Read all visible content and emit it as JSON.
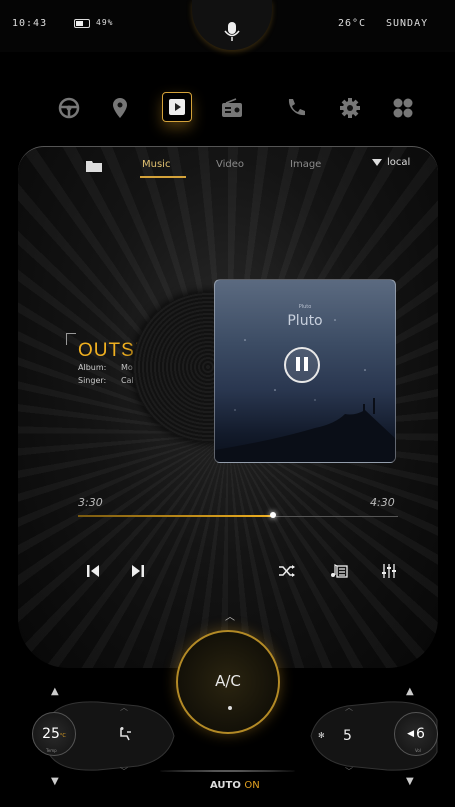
{
  "status": {
    "time": "10:43",
    "battery_pct": "49%",
    "battery_level": 0.49,
    "temperature": "26°C",
    "day": "SUNDAY"
  },
  "nav": {
    "items": [
      "steering-wheel",
      "location-pin",
      "media-play",
      "radio",
      "phone",
      "settings",
      "apps"
    ],
    "active": "media-play"
  },
  "media_tabs": {
    "music": "Music",
    "video": "Video",
    "image": "Image",
    "source": "local",
    "active": "Music"
  },
  "track": {
    "title": "OUTSIDE",
    "album_label": "Album:",
    "album": "Motion",
    "singer_label": "Singer:",
    "singer": "Calvin Harris",
    "card_caption_small": "Pluto",
    "card_caption": "Pluto"
  },
  "playback": {
    "elapsed": "3:30",
    "total": "4:30",
    "progress": 0.61
  },
  "climate": {
    "ac_label": "A/C",
    "left_temp": "25",
    "left_temp_unit": "°C",
    "left_temp_caption": "Temp",
    "fan_speed": "5",
    "volume": "6",
    "volume_caption": "Vol",
    "auto_label": "AUTO",
    "auto_state": "ON"
  },
  "colors": {
    "accent": "#f0b020",
    "background": "#000000"
  }
}
